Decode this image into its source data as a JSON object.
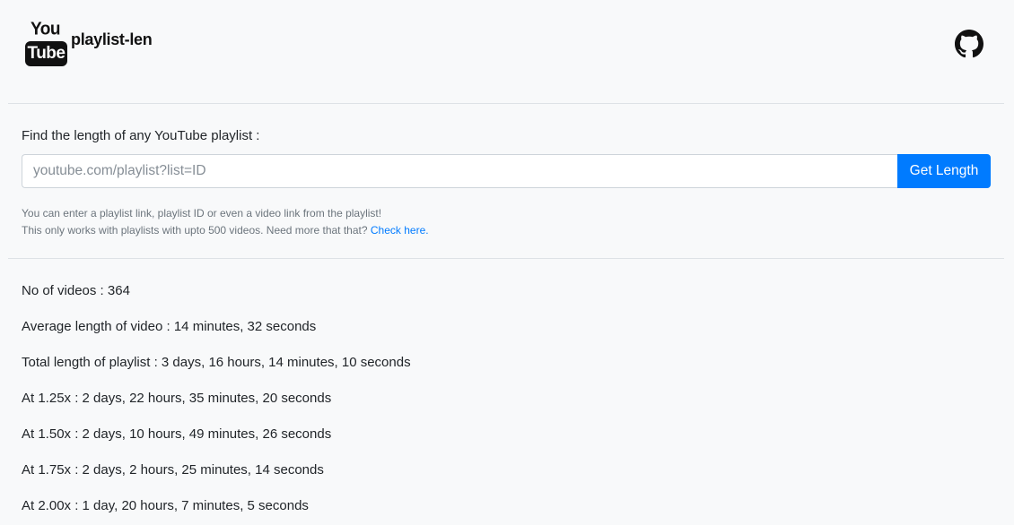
{
  "header": {
    "logo_top": "You",
    "logo_bottom": "Tube",
    "app_name": "playlist-len",
    "github_icon": "github-icon"
  },
  "form": {
    "label": "Find the length of any YouTube playlist :",
    "placeholder": "youtube.com/playlist?list=ID",
    "value": "",
    "button_label": "Get Length",
    "help_line1": "You can enter a playlist link, playlist ID or even a video link from the playlist!",
    "help_line2_prefix": "This only works with playlists with upto 500 videos. Need more that that?",
    "help_link": "Check here."
  },
  "results": [
    "No of videos : 364",
    "Average length of video : 14 minutes, 32 seconds",
    "Total length of playlist : 3 days, 16 hours, 14 minutes, 10 seconds",
    "At 1.25x : 2 days, 22 hours, 35 minutes, 20 seconds",
    "At 1.50x : 2 days, 10 hours, 49 minutes, 26 seconds",
    "At 1.75x : 2 days, 2 hours, 25 minutes, 14 seconds",
    "At 2.00x : 1 day, 20 hours, 7 minutes, 5 seconds"
  ],
  "colors": {
    "accent": "#007bff",
    "background": "#f8f9fa",
    "text": "#212529",
    "muted": "#6c757d"
  }
}
